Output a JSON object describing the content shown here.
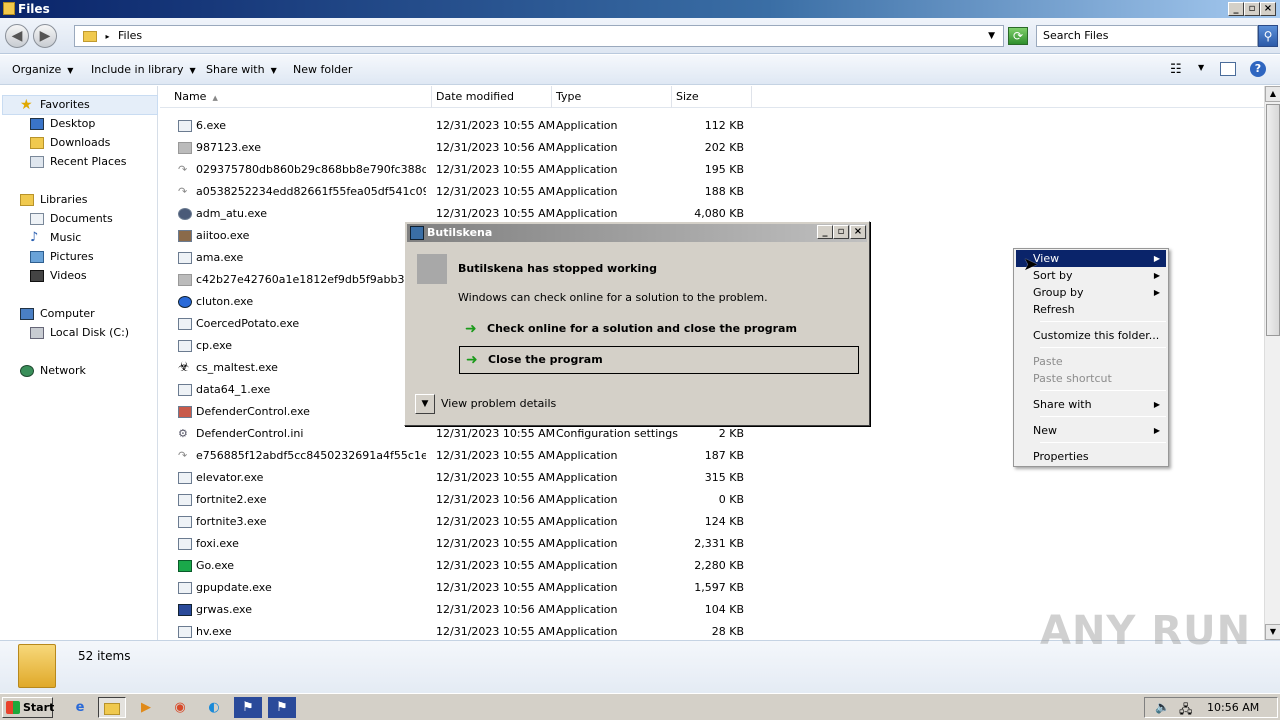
{
  "window": {
    "title": "Files"
  },
  "address": {
    "path": "Files",
    "search_placeholder": "Search Files"
  },
  "commands": {
    "organize": "Organize",
    "include_library": "Include in library",
    "share_with": "Share with",
    "new_folder": "New folder"
  },
  "nav": {
    "favorites": "Favorites",
    "desktop": "Desktop",
    "downloads": "Downloads",
    "recent": "Recent Places",
    "libraries": "Libraries",
    "documents": "Documents",
    "music": "Music",
    "pictures": "Pictures",
    "videos": "Videos",
    "computer": "Computer",
    "local_disk": "Local Disk (C:)",
    "network": "Network"
  },
  "columns": {
    "name": "Name",
    "date": "Date modified",
    "type": "Type",
    "size": "Size"
  },
  "files": [
    {
      "name": "6.exe",
      "date": "12/31/2023 10:55 AM",
      "type": "Application",
      "size": "112 KB"
    },
    {
      "name": "987123.exe",
      "date": "12/31/2023 10:56 AM",
      "type": "Application",
      "size": "202 KB"
    },
    {
      "name": "029375780db860b29c868bb8e790fc388d6a...",
      "date": "12/31/2023 10:55 AM",
      "type": "Application",
      "size": "195 KB"
    },
    {
      "name": "a0538252234edd82661f55fea05df541c095a...",
      "date": "12/31/2023 10:55 AM",
      "type": "Application",
      "size": "188 KB"
    },
    {
      "name": "adm_atu.exe",
      "date": "12/31/2023 10:55 AM",
      "type": "Application",
      "size": "4,080 KB"
    },
    {
      "name": "aiitoo.exe",
      "date": "",
      "type": "",
      "size": ""
    },
    {
      "name": "ama.exe",
      "date": "",
      "type": "",
      "size": ""
    },
    {
      "name": "c42b27e42760a1e1812ef9db5f9abb3424c5",
      "date": "",
      "type": "",
      "size": ""
    },
    {
      "name": "cluton.exe",
      "date": "",
      "type": "",
      "size": ""
    },
    {
      "name": "CoercedPotato.exe",
      "date": "",
      "type": "",
      "size": ""
    },
    {
      "name": "cp.exe",
      "date": "",
      "type": "",
      "size": ""
    },
    {
      "name": "cs_maltest.exe",
      "date": "",
      "type": "",
      "size": ""
    },
    {
      "name": "data64_1.exe",
      "date": "",
      "type": "",
      "size": ""
    },
    {
      "name": "DefenderControl.exe",
      "date": "",
      "type": "",
      "size": ""
    },
    {
      "name": "DefenderControl.ini",
      "date": "12/31/2023 10:55 AM",
      "type": "Configuration settings",
      "size": "2 KB"
    },
    {
      "name": "e756885f12abdf5cc8450232691a4f55c1e52...",
      "date": "12/31/2023 10:55 AM",
      "type": "Application",
      "size": "187 KB"
    },
    {
      "name": "elevator.exe",
      "date": "12/31/2023 10:55 AM",
      "type": "Application",
      "size": "315 KB"
    },
    {
      "name": "fortnite2.exe",
      "date": "12/31/2023 10:56 AM",
      "type": "Application",
      "size": "0 KB"
    },
    {
      "name": "fortnite3.exe",
      "date": "12/31/2023 10:55 AM",
      "type": "Application",
      "size": "124 KB"
    },
    {
      "name": "foxi.exe",
      "date": "12/31/2023 10:55 AM",
      "type": "Application",
      "size": "2,331 KB"
    },
    {
      "name": "Go.exe",
      "date": "12/31/2023 10:55 AM",
      "type": "Application",
      "size": "2,280 KB"
    },
    {
      "name": "gpupdate.exe",
      "date": "12/31/2023 10:55 AM",
      "type": "Application",
      "size": "1,597 KB"
    },
    {
      "name": "grwas.exe",
      "date": "12/31/2023 10:56 AM",
      "type": "Application",
      "size": "104 KB"
    },
    {
      "name": "hv.exe",
      "date": "12/31/2023 10:55 AM",
      "type": "Application",
      "size": "28 KB"
    }
  ],
  "status": {
    "items": "52 items"
  },
  "dialog": {
    "title": "Butilskena",
    "heading": "Butilskena has stopped working",
    "message": "Windows can check online for a solution to the problem.",
    "opt_check": "Check online for a solution and close the program",
    "opt_close": "Close the program",
    "details": "View problem details"
  },
  "context_menu": {
    "view": "View",
    "sort_by": "Sort by",
    "group_by": "Group by",
    "refresh": "Refresh",
    "customize": "Customize this folder...",
    "paste": "Paste",
    "paste_shortcut": "Paste shortcut",
    "share_with": "Share with",
    "new": "New",
    "properties": "Properties"
  },
  "taskbar": {
    "start": "Start",
    "clock": "10:56 AM"
  },
  "watermark": "ANY RUN"
}
